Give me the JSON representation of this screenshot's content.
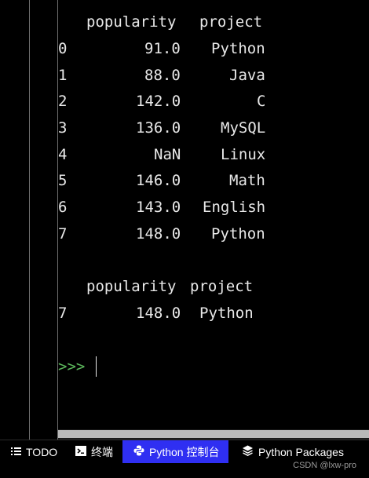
{
  "console": {
    "table1": {
      "headers": [
        "popularity",
        "project"
      ],
      "rows": [
        {
          "index": "0",
          "popularity": "91.0",
          "project": "Python"
        },
        {
          "index": "1",
          "popularity": "88.0",
          "project": "Java"
        },
        {
          "index": "2",
          "popularity": "142.0",
          "project": "C"
        },
        {
          "index": "3",
          "popularity": "136.0",
          "project": "MySQL"
        },
        {
          "index": "4",
          "popularity": "NaN",
          "project": "Linux"
        },
        {
          "index": "5",
          "popularity": "146.0",
          "project": "Math"
        },
        {
          "index": "6",
          "popularity": "143.0",
          "project": "English"
        },
        {
          "index": "7",
          "popularity": "148.0",
          "project": "Python"
        }
      ]
    },
    "table2": {
      "headers": [
        "popularity",
        "project"
      ],
      "rows": [
        {
          "index": "7",
          "popularity": "148.0",
          "project": "Python"
        }
      ]
    },
    "prompt": ">>>",
    "prompt_color": "#5cb85c"
  },
  "toolbar": {
    "tabs": [
      {
        "label": "TODO",
        "icon": "list-icon",
        "active": false
      },
      {
        "label": "终端",
        "icon": "terminal-icon",
        "active": false
      },
      {
        "label": "Python 控制台",
        "icon": "python-icon",
        "active": true
      },
      {
        "label": "Python Packages",
        "icon": "layers-icon",
        "active": false
      }
    ],
    "active_color": "#2f2ff2"
  },
  "watermark": "CSDN @lxw-pro"
}
